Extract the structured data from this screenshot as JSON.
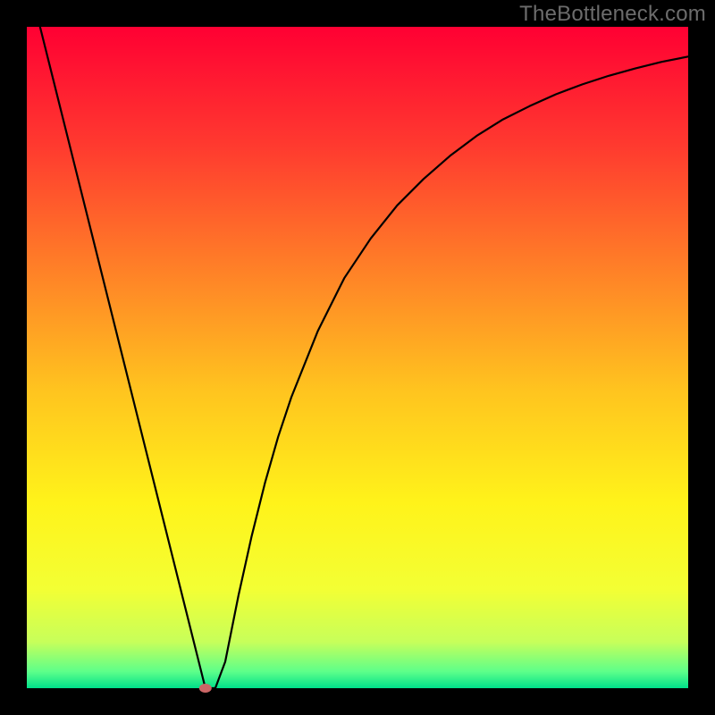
{
  "watermark": "TheBottleneck.com",
  "chart_data": {
    "type": "line",
    "title": "",
    "xlabel": "",
    "ylabel": "",
    "xlim": [
      0,
      100
    ],
    "ylim": [
      0,
      100
    ],
    "grid": false,
    "legend": false,
    "annotations": [],
    "background_gradient": {
      "stops": [
        {
          "offset": 0.0,
          "color": "#ff0033"
        },
        {
          "offset": 0.18,
          "color": "#ff3a2f"
        },
        {
          "offset": 0.35,
          "color": "#ff7a28"
        },
        {
          "offset": 0.55,
          "color": "#ffc41f"
        },
        {
          "offset": 0.72,
          "color": "#fff31a"
        },
        {
          "offset": 0.85,
          "color": "#f3ff34"
        },
        {
          "offset": 0.93,
          "color": "#c7ff5a"
        },
        {
          "offset": 0.975,
          "color": "#5dff8a"
        },
        {
          "offset": 1.0,
          "color": "#00e08a"
        }
      ]
    },
    "series": [
      {
        "name": "bottleneck-curve",
        "color": "#000000",
        "x": [
          0,
          2,
          4,
          6,
          8,
          10,
          12,
          14,
          16,
          18,
          20,
          22,
          24,
          26,
          27,
          28.5,
          30,
          32,
          34,
          36,
          38,
          40,
          44,
          48,
          52,
          56,
          60,
          64,
          68,
          72,
          76,
          80,
          84,
          88,
          92,
          96,
          100
        ],
        "values": [
          108,
          100,
          92,
          84,
          76,
          68,
          60,
          52,
          44,
          36,
          28,
          20,
          12,
          4,
          0,
          0,
          4,
          14,
          23,
          31,
          38,
          44,
          54,
          62,
          68,
          73,
          77,
          80.5,
          83.5,
          86,
          88,
          89.8,
          91.3,
          92.6,
          93.7,
          94.7,
          95.5
        ]
      }
    ],
    "marker": {
      "x": 27,
      "y": 0,
      "color": "#cc6666",
      "rx": 7,
      "ry": 5
    }
  }
}
